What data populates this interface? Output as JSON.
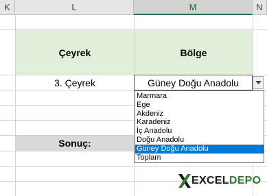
{
  "columns": {
    "k": "K",
    "l": "L",
    "m": "M",
    "n": "N"
  },
  "table": {
    "header_quarter": "Çeyrek",
    "header_region": "Bölge",
    "quarter_value": "3. Çeyrek",
    "region_value": "Güney Doğu Anadolu",
    "result_label": "Sonuç:"
  },
  "dropdown": {
    "options": [
      "Marmara",
      "Ege",
      "Akdeniz",
      "Karadeniz",
      "İç Anadolu",
      "Doğu Anadolu",
      "Güney Doğu Anadolu",
      "Toplam"
    ],
    "selected_index": 6
  },
  "logo": {
    "word1": "EXCEL",
    "word2": "DEPO"
  },
  "colors": {
    "header_fill": "#e2efda",
    "result_fill": "#d9d9d9",
    "selection": "#0078d7",
    "excel_green": "#217346"
  }
}
